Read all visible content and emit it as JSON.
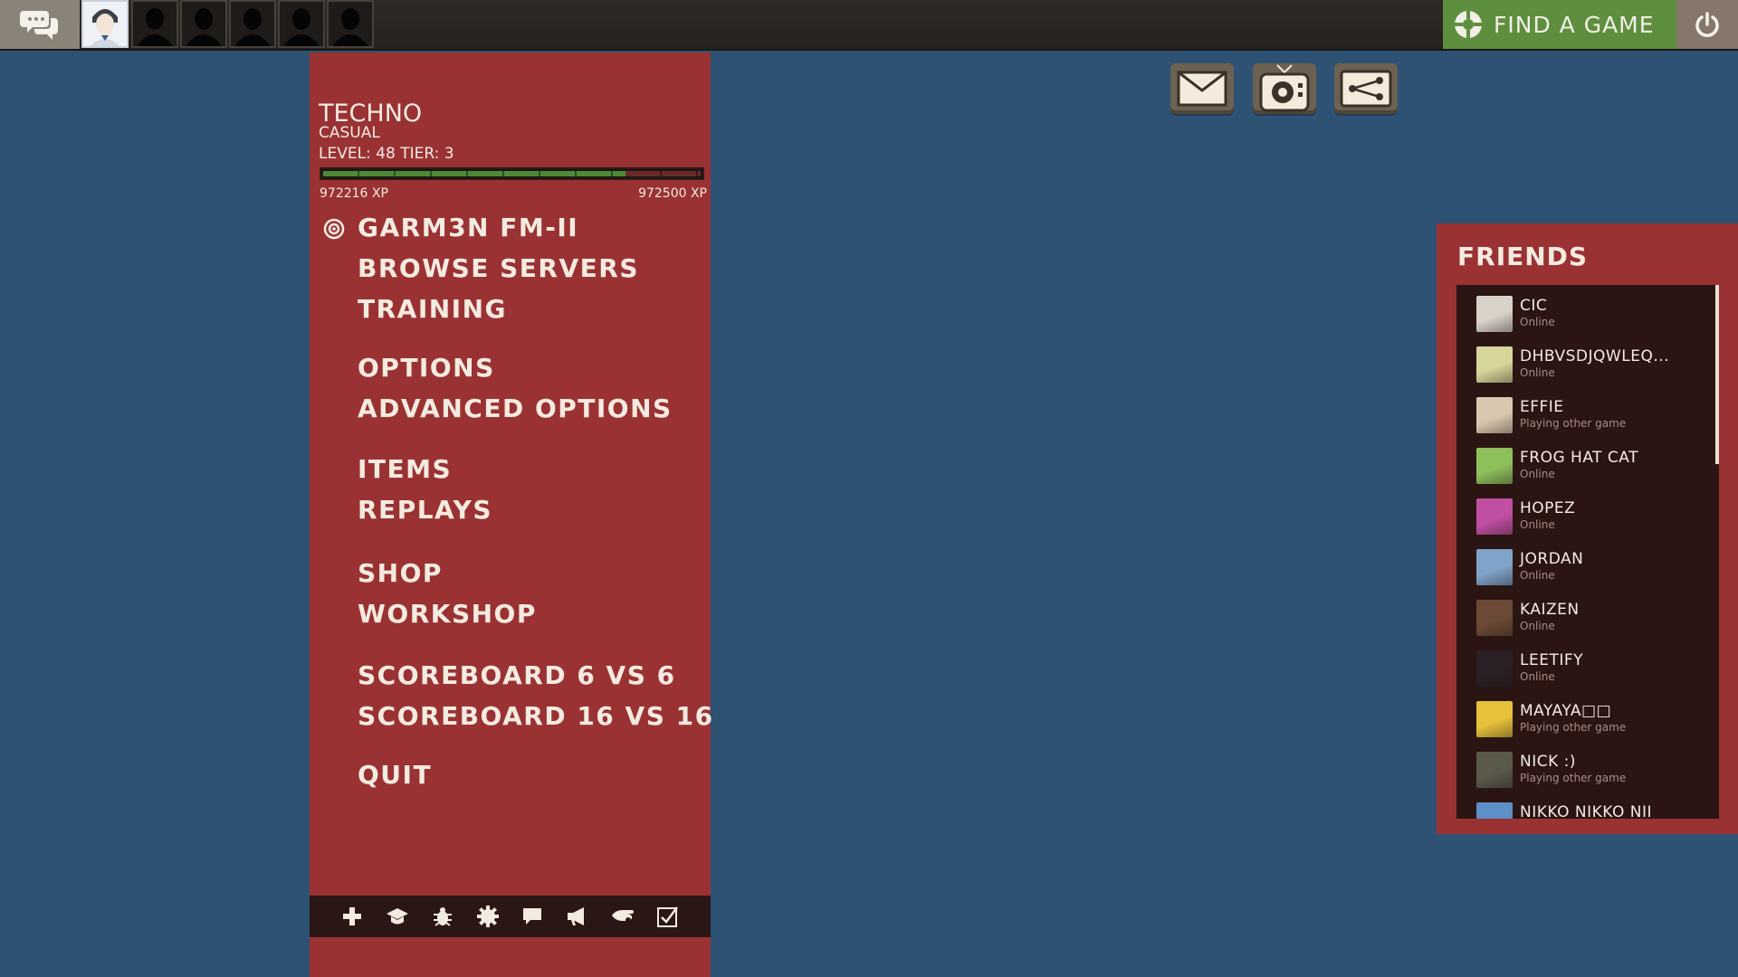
{
  "colors": {
    "background": "#2e5273",
    "panel_red": "#9a3234",
    "find_game_green": "#5e8f3f",
    "friends_list_bg": "#2a1513"
  },
  "topbar": {
    "chat_icon": "chat-bubbles-icon",
    "party_slots": [
      "player-avatar",
      "empty-slot",
      "empty-slot",
      "empty-slot",
      "empty-slot",
      "empty-slot"
    ],
    "find_game_label": "FIND A GAME",
    "power_icon": "power-icon"
  },
  "top_icons": [
    "mail-icon",
    "tv-icon",
    "network-icon"
  ],
  "player": {
    "name": "TECHNO",
    "mode": "CASUAL",
    "level_text": "LEVEL: 48 TIER: 3",
    "xp_current": "972216 XP",
    "xp_max": "972500 XP",
    "xp_progress": 0.8
  },
  "menu": {
    "server": "GARM3N FM-II",
    "browse_servers": "BROWSE SERVERS",
    "training": "TRAINING",
    "options": "OPTIONS",
    "advanced_options": "ADVANCED OPTIONS",
    "items": "ITEMS",
    "replays": "REPLAYS",
    "shop": "SHOP",
    "workshop": "WORKSHOP",
    "scoreboard_6v6": "SCOREBOARD 6 VS 6",
    "scoreboard_16v16": "SCOREBOARD 16 VS 16",
    "quit": "QUIT"
  },
  "bottom_icons": [
    "plus-icon",
    "graduation-cap-icon",
    "bug-icon",
    "gear-icon",
    "comment-icon",
    "megaphone-icon",
    "hand-icon",
    "checkbox-icon"
  ],
  "friends": {
    "title": "FRIENDS",
    "items": [
      {
        "name": "CIC",
        "status": "Online",
        "color": "#d9d2c8"
      },
      {
        "name": "DHBVSDJQWLEQ...",
        "status": "Online",
        "color": "#d8d59a"
      },
      {
        "name": "EFFIE",
        "status": "Playing other game",
        "color": "#d9c8b0"
      },
      {
        "name": "FROG HAT CAT",
        "status": "Online",
        "color": "#8fbf5a"
      },
      {
        "name": "HOPEZ",
        "status": "Online",
        "color": "#c04fa3"
      },
      {
        "name": "JORDAN",
        "status": "Online",
        "color": "#7fa3c9"
      },
      {
        "name": "KAIZEN",
        "status": "Online",
        "color": "#6b4a36"
      },
      {
        "name": "LEETIFY",
        "status": "Online",
        "color": "#2b2024"
      },
      {
        "name": "MAYAYA□□",
        "status": "Playing other game",
        "color": "#e6c23a"
      },
      {
        "name": "NICK :)",
        "status": "Playing other game",
        "color": "#5a5a4a"
      },
      {
        "name": "NIKKO NIKKO NII",
        "status": "",
        "color": "#5d8fc8"
      }
    ]
  }
}
